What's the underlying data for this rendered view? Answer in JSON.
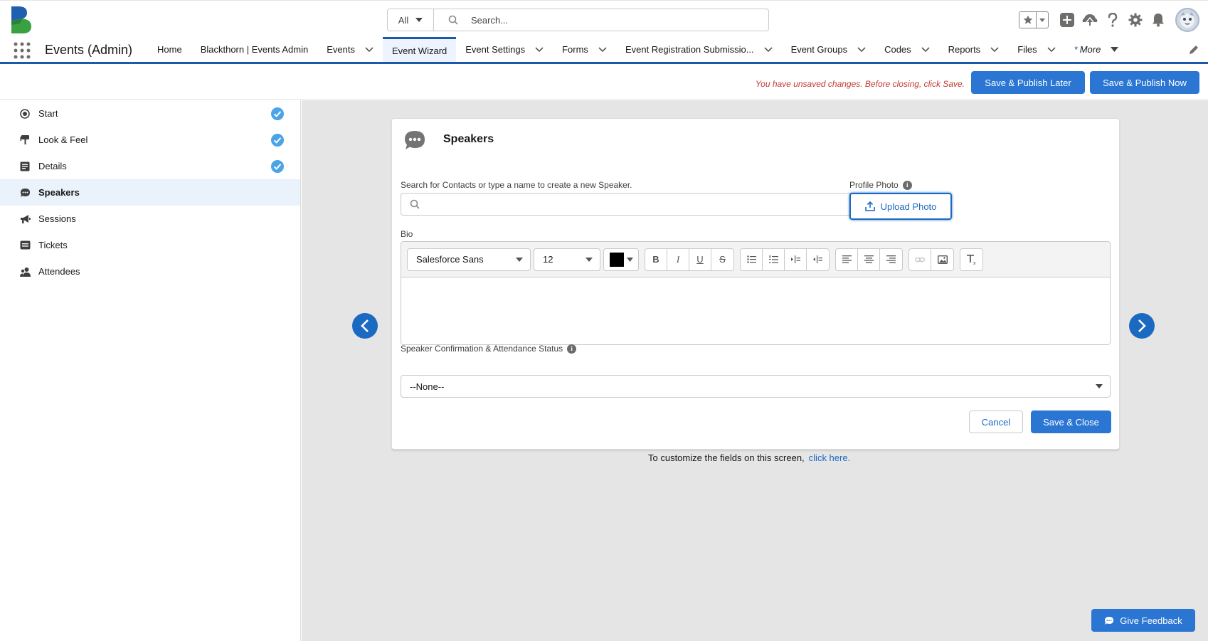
{
  "header": {
    "search_scope": "All",
    "search_placeholder": "Search..."
  },
  "nav": {
    "app_name": "Events (Admin)",
    "items": [
      {
        "label": "Home",
        "dropdown": false
      },
      {
        "label": "Blackthorn | Events Admin",
        "dropdown": false
      },
      {
        "label": "Events",
        "dropdown": true
      },
      {
        "label": "Event Wizard",
        "dropdown": false,
        "active": true
      },
      {
        "label": "Event Settings",
        "dropdown": true
      },
      {
        "label": "Forms",
        "dropdown": true
      },
      {
        "label": "Event Registration Submissio...",
        "dropdown": true
      },
      {
        "label": "Event Groups",
        "dropdown": true
      },
      {
        "label": "Codes",
        "dropdown": true
      },
      {
        "label": "Reports",
        "dropdown": true
      },
      {
        "label": "Files",
        "dropdown": true
      }
    ],
    "more_marker": "*",
    "more_label": "More"
  },
  "actions": {
    "unsaved_message": "You have unsaved changes. Before closing, click Save.",
    "publish_later": "Save & Publish Later",
    "publish_now": "Save & Publish Now"
  },
  "sidebar": {
    "steps": [
      {
        "label": "Start",
        "icon": "record-icon",
        "done": true
      },
      {
        "label": "Look & Feel",
        "icon": "paint-icon",
        "done": true
      },
      {
        "label": "Details",
        "icon": "details-icon",
        "done": true
      },
      {
        "label": "Speakers",
        "icon": "chat-icon",
        "done": false,
        "active": true
      },
      {
        "label": "Sessions",
        "icon": "megaphone-icon",
        "done": false
      },
      {
        "label": "Tickets",
        "icon": "ticket-icon",
        "done": false
      },
      {
        "label": "Attendees",
        "icon": "people-icon",
        "done": false
      }
    ]
  },
  "speaker_form": {
    "title": "Speakers",
    "search_label": "Search for Contacts or type a name to create a new Speaker.",
    "profile_photo_label": "Profile Photo",
    "upload_photo": "Upload Photo",
    "bio_label": "Bio",
    "font_family": "Salesforce Sans",
    "font_size": "12",
    "text_color": "#000000",
    "status_label": "Speaker Confirmation & Attendance Status",
    "status_value": "--None--",
    "cancel": "Cancel",
    "save_close": "Save & Close"
  },
  "footer": {
    "note": "To customize the fields on this screen,",
    "link": "click here."
  },
  "feedback": {
    "label": "Give Feedback"
  },
  "colors": {
    "brand": "#2b76d3",
    "nav_accent": "#1b5aa8",
    "error": "#c23934",
    "check": "#4ba3e8"
  }
}
